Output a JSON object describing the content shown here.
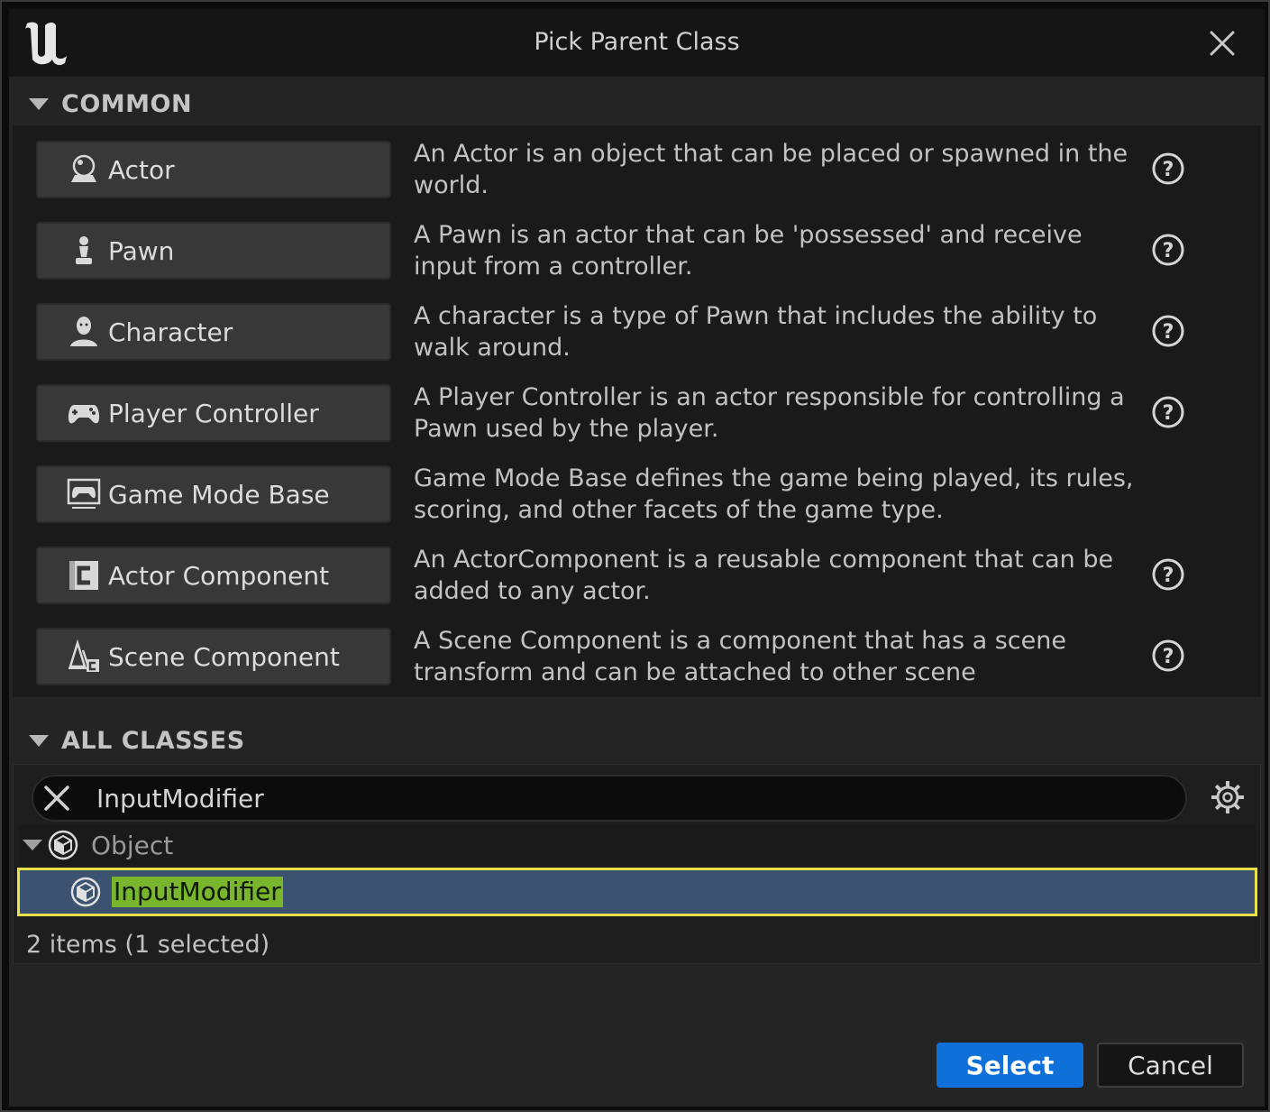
{
  "window": {
    "title": "Pick Parent Class"
  },
  "common": {
    "header": "COMMON",
    "items": [
      {
        "label": "Actor",
        "icon": "actor-icon",
        "description": "An Actor is an object that can be placed or spawned in the world.",
        "has_help": true
      },
      {
        "label": "Pawn",
        "icon": "pawn-icon",
        "description": "A Pawn is an actor that can be 'possessed' and receive input from a controller.",
        "has_help": true
      },
      {
        "label": "Character",
        "icon": "character-icon",
        "description": "A character is a type of Pawn that includes the ability to walk around.",
        "has_help": true
      },
      {
        "label": "Player Controller",
        "icon": "gamepad-icon",
        "description": "A Player Controller is an actor responsible for controlling a Pawn used by the player.",
        "has_help": true
      },
      {
        "label": "Game Mode Base",
        "icon": "game-mode-icon",
        "description": "Game Mode Base defines the game being played, its rules, scoring, and other facets of the game type.",
        "has_help": false
      },
      {
        "label": "Actor Component",
        "icon": "actor-component-icon",
        "description": "An ActorComponent is a reusable component that can be added to any actor.",
        "has_help": true
      },
      {
        "label": "Scene Component",
        "icon": "scene-component-icon",
        "description": "A Scene Component is a component that has a scene transform and can be attached to other scene",
        "has_help": true
      }
    ]
  },
  "all_classes": {
    "header": "ALL CLASSES",
    "search_value": "InputModifier",
    "tree": {
      "parent": "Object",
      "child": "InputModifier"
    },
    "status": "2 items (1 selected)"
  },
  "buttons": {
    "select": "Select",
    "cancel": "Cancel"
  },
  "colors": {
    "accent": "#0f70d9",
    "selection_row": "#3b5270",
    "selection_border": "#e9e04a",
    "search_highlight": "#79b52d"
  }
}
